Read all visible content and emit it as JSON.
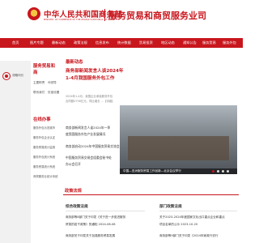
{
  "header": {
    "org_name_cn": "中华人民共和国商务部",
    "org_name_en": "MINISTRY OF COMMERCE OF THE PEOPLE'S REPUBLIC OF CHINA",
    "site_title": "服务贸易和商贸服务业司"
  },
  "nav": {
    "items": [
      "首页",
      "图片专题",
      "最新动态",
      "政策法规",
      "信息发布",
      "统计数据",
      "贸易投资",
      "地区动态",
      "通知公告",
      "服务贸易",
      "服务外包"
    ]
  },
  "left_col": {
    "link": "领略司长"
  },
  "sidebar": {
    "title_1": "服务贸易和",
    "title_2": "商",
    "links": [
      "主要职责",
      "司领导",
      "联系我们",
      "处室设置"
    ],
    "online_title": "在线办事",
    "online_items": [
      "服务外包示范城市",
      "服务外包企业认定",
      "服务贸易统计监测",
      "服务外包统计系统",
      "服务贸易统计系统",
      "商贸服务业统计系统"
    ]
  },
  "main": {
    "latest_title": "最新动态",
    "headline_1": "商务部新闻发言人谈2024年",
    "headline_2": "1-4月我国服务外包工作",
    "summary_1": "2024年1-4月，我国企业承接服务外包",
    "summary_2": "合同额4756亿元，同比增长 ...【详细】",
    "news": [
      "商务部新闻发言人谈2024年一季",
      "度我国服务外包产业发展情况",
      "商务部启动2024年中国服务贸易交流会",
      "中国服务贸易交易会组委会秘书处",
      "办公会召开"
    ]
  },
  "photo": {
    "caption": "中国—亚洲服务贸易工作创新—北京会议举行"
  },
  "policy": {
    "section_title": "政策法规",
    "sub_left": "综合政策法规",
    "sub_right": "部门政策法规",
    "left_items": [
      "商务部等8部门关于印发《关于进一步促进服务",
      "贸易的若干政策》的通知 2024-08-08",
      "商务部关于印发关于加强服务贸易发展"
    ],
    "right_items": [
      "关于2023-2024年度国家文化出口重点企业和重点",
      "项目名单的公示 2023-10-20",
      "商务部等9部门关于印发《2024年家政兴农行"
    ]
  }
}
